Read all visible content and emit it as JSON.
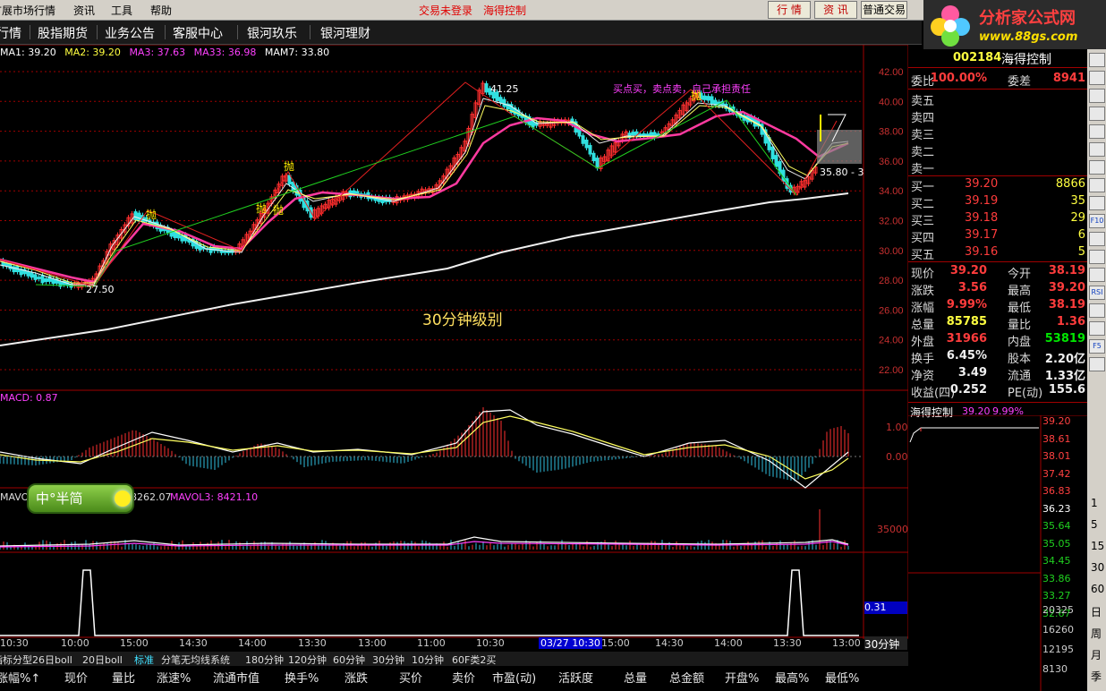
{
  "menu": {
    "items": [
      "扩展市场行情",
      "资讯",
      "工具",
      "帮助"
    ],
    "status1": "交易未登录",
    "status2": "海得控制",
    "btn_quote": "行 情",
    "btn_news": "资 讯",
    "btn_trade": "普通交易"
  },
  "nav": [
    "行情",
    "股指期货",
    "业务公告",
    "客服中心",
    "银河玖乐",
    "银河理财"
  ],
  "logo": {
    "title": "分析家公式网",
    "url": "www.88gs.com"
  },
  "ma_legend": [
    {
      "text": "MA1: 39.20",
      "color": "#ffffff"
    },
    {
      "text": "MA2: 39.20",
      "color": "#ffff40"
    },
    {
      "text": "MA3: 37.63",
      "color": "#ff40ff"
    },
    {
      "text": "MA33: 36.98",
      "color": "#ff40ff"
    },
    {
      "text": "MAM7: 33.80",
      "color": "#ffffff"
    }
  ],
  "chart_data": {
    "type": "candlestick",
    "title": "30分钟级别",
    "annotation": "买点买，卖点卖，自己承担责任",
    "y_ticks": [
      "42.00",
      "40.00",
      "38.00",
      "36.00",
      "34.00",
      "32.00",
      "30.00",
      "28.00",
      "26.00",
      "24.00",
      "22.00"
    ],
    "markers": [
      "41.25",
      "27.50",
      "35.80 - 3"
    ],
    "sell_markers": [
      "抛",
      "抛",
      "抛",
      "抛",
      "抛"
    ]
  },
  "macd": {
    "label": "MACD: 0.87",
    "ticks": [
      "1.00",
      "0.00"
    ]
  },
  "mavol": {
    "label": "MAVOL",
    "v2": "8262.07",
    "v3_label": "MAVOL3: 8421.10",
    "tick": "35000"
  },
  "ime": {
    "text": "中°半简"
  },
  "indicator": {
    "value": "0.31"
  },
  "time_axis": [
    "10:30",
    "10:00",
    "15:00",
    "14:30",
    "14:00",
    "13:30",
    "13:00",
    "11:00",
    "10:30",
    "03/27 10:30",
    "15:00",
    "14:30",
    "14:00",
    "13:30",
    "13:00"
  ],
  "period": "30分钟",
  "tabs": [
    "指标分型",
    "26日boll",
    "20日boll",
    "标准",
    "分笔无均线系统",
    "180分钟",
    "120分钟",
    "60分钟",
    "30分钟",
    "10分钟",
    "60F类2买"
  ],
  "columns": [
    "涨幅%↑",
    "现价",
    "量比",
    "涨速%",
    "流通市值",
    "换手%",
    "涨跌",
    "买价",
    "卖价",
    "市盈(动)",
    "活跃度",
    "总量",
    "总金额",
    "开盘%",
    "最高%",
    "最低%"
  ],
  "quote": {
    "code": "002184",
    "name": "海得控制",
    "weibi_label": "委比",
    "weibi": "100.00%",
    "weicha_label": "委差",
    "weicha": "8941",
    "sell": [
      "卖五",
      "卖四",
      "卖三",
      "卖二",
      "卖一"
    ],
    "buy": [
      {
        "label": "买一",
        "price": "39.20",
        "vol": "8866"
      },
      {
        "label": "买二",
        "price": "39.19",
        "vol": "35"
      },
      {
        "label": "买三",
        "price": "39.18",
        "vol": "29"
      },
      {
        "label": "买四",
        "price": "39.17",
        "vol": "6"
      },
      {
        "label": "买五",
        "price": "39.16",
        "vol": "5"
      }
    ],
    "stats": [
      {
        "l1": "现价",
        "v1": "39.20",
        "c1": "red",
        "l2": "今开",
        "v2": "38.19",
        "c2": "red"
      },
      {
        "l1": "涨跌",
        "v1": "3.56",
        "c1": "red",
        "l2": "最高",
        "v2": "39.20",
        "c2": "red"
      },
      {
        "l1": "涨幅",
        "v1": "9.99%",
        "c1": "red",
        "l2": "最低",
        "v2": "38.19",
        "c2": "red"
      },
      {
        "l1": "总量",
        "v1": "85785",
        "c1": "yel",
        "l2": "量比",
        "v2": "1.36",
        "c2": "red"
      },
      {
        "l1": "外盘",
        "v1": "31966",
        "c1": "red",
        "l2": "内盘",
        "v2": "53819",
        "c2": "grn"
      },
      {
        "l1": "换手",
        "v1": "6.45%",
        "c1": "wht",
        "l2": "股本",
        "v2": "2.20亿",
        "c2": "wht"
      },
      {
        "l1": "净资",
        "v1": "3.49",
        "c1": "wht",
        "l2": "流通",
        "v2": "1.33亿",
        "c2": "wht"
      },
      {
        "l1": "收益(四)",
        "v1": "0.252",
        "c1": "wht",
        "l2": "PE(动)",
        "v2": "155.6",
        "c2": "wht"
      }
    ],
    "mini_title": "海得控制",
    "mini_price": "39.20",
    "mini_pct": "9.99%",
    "mini_ticks": [
      "39.20",
      "38.61",
      "38.01",
      "37.42",
      "36.83",
      "36.23",
      "35.64",
      "35.05",
      "34.45",
      "33.86",
      "33.27",
      "32.67"
    ],
    "mini_vol": [
      "20325",
      "16260",
      "12195",
      "8130"
    ]
  },
  "right_toolbar": [
    "1",
    "5",
    "15",
    "30",
    "60",
    "日",
    "周",
    "月",
    "季"
  ]
}
